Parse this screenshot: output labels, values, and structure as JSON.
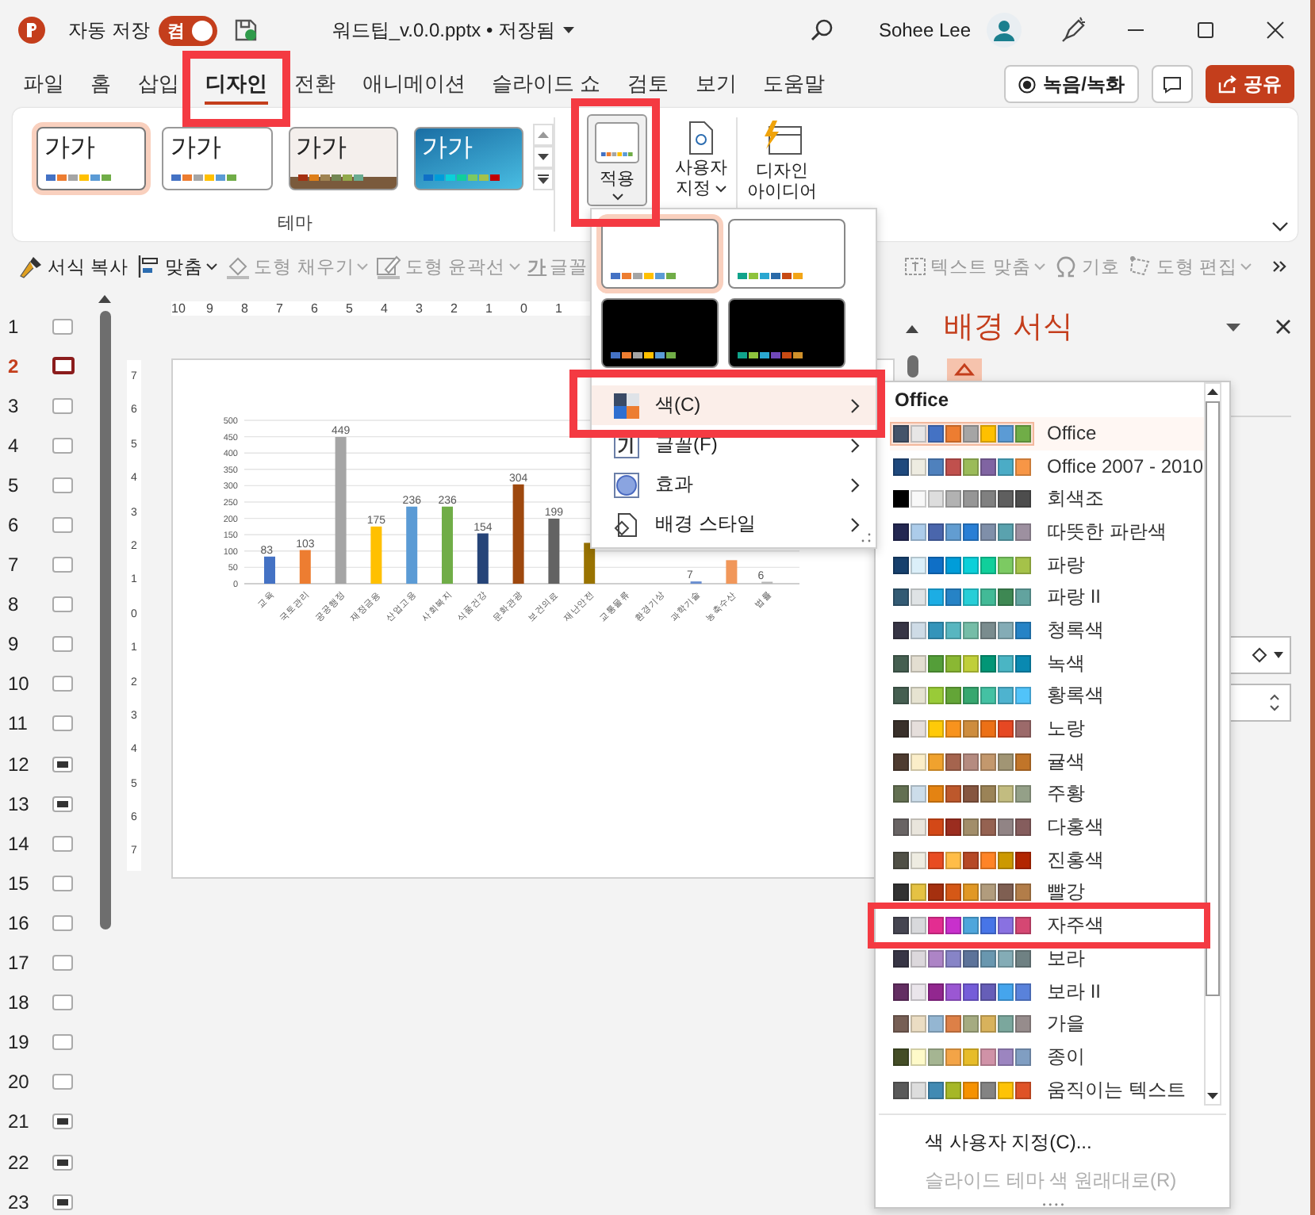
{
  "titlebar": {
    "autosave_label": "자동 저장",
    "autosave_toggle": {
      "label": "켬",
      "on": true
    },
    "filename": "워드팁_v.0.0.pptx • 저장됨",
    "user": "Sohee Lee"
  },
  "tabs": [
    {
      "label": "파일",
      "selected": false,
      "highlighted": false
    },
    {
      "label": "홈",
      "selected": false,
      "highlighted": false
    },
    {
      "label": "삽입",
      "selected": false,
      "highlighted": false
    },
    {
      "label": "디자인",
      "selected": true,
      "highlighted": true
    },
    {
      "label": "전환",
      "selected": false,
      "highlighted": false
    },
    {
      "label": "애니메이션",
      "selected": false,
      "highlighted": false
    },
    {
      "label": "슬라이드 쇼",
      "selected": false,
      "highlighted": false
    },
    {
      "label": "검토",
      "selected": false,
      "highlighted": false
    },
    {
      "label": "보기",
      "selected": false,
      "highlighted": false
    },
    {
      "label": "도움말",
      "selected": false,
      "highlighted": false
    }
  ],
  "header_buttons": {
    "record": "녹음/녹화",
    "share": "공유"
  },
  "ribbon": {
    "themes": [
      {
        "sample": "가가",
        "kind": "plain",
        "selected": true,
        "swatches": [
          {
            "color": "#4472c4"
          },
          {
            "color": "#ed7d31"
          },
          {
            "color": "#a5a5a5"
          },
          {
            "color": "#ffc000"
          },
          {
            "color": "#5b9bd5"
          },
          {
            "color": "#70ad47"
          }
        ]
      },
      {
        "sample": "가가",
        "kind": "plain",
        "selected": false,
        "swatches": [
          {
            "color": "#4472c4"
          },
          {
            "color": "#ed7d31"
          },
          {
            "color": "#a5a5a5"
          },
          {
            "color": "#ffc000"
          },
          {
            "color": "#5b9bd5"
          },
          {
            "color": "#70ad47"
          }
        ]
      },
      {
        "sample": "가가",
        "kind": "textured",
        "selected": false,
        "swatches": [
          {
            "color": "#a53010"
          },
          {
            "color": "#de7e18"
          },
          {
            "color": "#9f8351"
          },
          {
            "color": "#728653"
          },
          {
            "color": "#92aa4c"
          },
          {
            "color": "#6aac91"
          }
        ]
      },
      {
        "sample": "가가",
        "kind": "gradient",
        "selected": false,
        "swatches": [
          {
            "color": "#0f6fc6"
          },
          {
            "color": "#009dd9"
          },
          {
            "color": "#0bd0d9"
          },
          {
            "color": "#10cf9b"
          },
          {
            "color": "#7cca62"
          },
          {
            "color": "#a5c249"
          },
          {
            "color": "#c00000"
          }
        ]
      }
    ],
    "apply": {
      "label": "적용",
      "highlighted": true
    },
    "customize": "사용자 지정",
    "design_ideas": "디자인 아이디어",
    "group_label": "테마"
  },
  "toolbar": {
    "left": [
      {
        "label": "서식 복사",
        "disabled": false,
        "caret": false
      },
      {
        "label": "맞춤",
        "disabled": false,
        "caret": true
      },
      {
        "label": "도형 채우기",
        "disabled": true,
        "caret": true
      },
      {
        "label": "도형 윤곽선",
        "disabled": true,
        "caret": true
      },
      {
        "label": "글꼴",
        "glyph": "가",
        "disabled": true,
        "caret": false
      }
    ],
    "right": [
      {
        "label": "텍스트 맞춤",
        "disabled": true,
        "caret": true
      },
      {
        "label": "기호",
        "disabled": true,
        "caret": false
      },
      {
        "label": "도형 편집",
        "disabled": true,
        "caret": true
      }
    ]
  },
  "slides": [
    {
      "number": "1",
      "selected": false,
      "kind": "blank"
    },
    {
      "number": "2",
      "selected": true,
      "kind": "blank"
    },
    {
      "number": "3",
      "selected": false,
      "kind": "blank"
    },
    {
      "number": "4",
      "selected": false,
      "kind": "blank"
    },
    {
      "number": "5",
      "selected": false,
      "kind": "blank"
    },
    {
      "number": "6",
      "selected": false,
      "kind": "blank"
    },
    {
      "number": "7",
      "selected": false,
      "kind": "blank"
    },
    {
      "number": "8",
      "selected": false,
      "kind": "blank"
    },
    {
      "number": "9",
      "selected": false,
      "kind": "blank"
    },
    {
      "number": "10",
      "selected": false,
      "kind": "blank"
    },
    {
      "number": "11",
      "selected": false,
      "kind": "blank"
    },
    {
      "number": "12",
      "selected": false,
      "kind": "content"
    },
    {
      "number": "13",
      "selected": false,
      "kind": "content"
    },
    {
      "number": "14",
      "selected": false,
      "kind": "blank"
    },
    {
      "number": "15",
      "selected": false,
      "kind": "blank"
    },
    {
      "number": "16",
      "selected": false,
      "kind": "blank"
    },
    {
      "number": "17",
      "selected": false,
      "kind": "blank"
    },
    {
      "number": "18",
      "selected": false,
      "kind": "blank"
    },
    {
      "number": "19",
      "selected": false,
      "kind": "blank"
    },
    {
      "number": "20",
      "selected": false,
      "kind": "blank"
    },
    {
      "number": "21",
      "selected": false,
      "kind": "content"
    },
    {
      "number": "22",
      "selected": false,
      "kind": "content"
    },
    {
      "number": "23",
      "selected": false,
      "kind": "content"
    }
  ],
  "ruler": {
    "horizontal": [
      "10",
      "9",
      "8",
      "7",
      "6",
      "5",
      "4",
      "3",
      "2",
      "1",
      "0",
      "1"
    ],
    "vertical": [
      "7",
      "6",
      "5",
      "4",
      "3",
      "2",
      "1",
      "0",
      "1",
      "2",
      "3",
      "4",
      "5",
      "6",
      "7"
    ]
  },
  "slide": {
    "chart_data": {
      "type": "bar",
      "categories": [
        "교육",
        "국토관리",
        "공공행정",
        "재정금융",
        "산업고용",
        "사회복지",
        "식품건강",
        "문화관광",
        "보건의료",
        "재난안전",
        "교통물류",
        "환경기상",
        "과학기술",
        "농축수산",
        "법률"
      ],
      "values": [
        83,
        103,
        449,
        175,
        236,
        236,
        154,
        304,
        199,
        125,
        null,
        null,
        7,
        72,
        6
      ],
      "value_labels": [
        "83",
        "103",
        "449",
        "175",
        "236",
        "236",
        "154",
        "304",
        "199",
        null,
        null,
        null,
        "7",
        null,
        "6"
      ],
      "ylim": [
        0,
        500
      ],
      "yticks": [
        0,
        50,
        100,
        150,
        200,
        250,
        300,
        350,
        400,
        450,
        500
      ],
      "grid": true
    }
  },
  "pane": {
    "title": "배경 서식"
  },
  "design_menu": {
    "variants": [
      {
        "kind": "light",
        "selected": true,
        "swatches": [
          {
            "color": "#4472c4"
          },
          {
            "color": "#ed7d31"
          },
          {
            "color": "#a5a5a5"
          },
          {
            "color": "#ffc000"
          },
          {
            "color": "#5b9bd5"
          },
          {
            "color": "#70ad47"
          }
        ]
      },
      {
        "kind": "light",
        "selected": false,
        "swatches": [
          {
            "color": "#10a38b"
          },
          {
            "color": "#8ec33d"
          },
          {
            "color": "#2aa7d1"
          },
          {
            "color": "#2a6aa8"
          },
          {
            "color": "#c84a14"
          },
          {
            "color": "#f2a517"
          }
        ]
      },
      {
        "kind": "dark",
        "selected": false,
        "swatches": [
          {
            "color": "#4472c4"
          },
          {
            "color": "#ed7d31"
          },
          {
            "color": "#a5a5a5"
          },
          {
            "color": "#ffc000"
          },
          {
            "color": "#5b9bd5"
          },
          {
            "color": "#70ad47"
          }
        ]
      },
      {
        "kind": "dark",
        "selected": false,
        "swatches": [
          {
            "color": "#10a38b"
          },
          {
            "color": "#8ec33d"
          },
          {
            "color": "#2aa7d1"
          },
          {
            "color": "#7048b8"
          },
          {
            "color": "#c84a14"
          },
          {
            "color": "#d0902a"
          }
        ]
      }
    ],
    "items": [
      {
        "label": "색(C)",
        "hover": true,
        "highlighted": true
      },
      {
        "label": "글꼴(F)",
        "hover": false,
        "highlighted": false
      },
      {
        "label": "효과",
        "hover": false,
        "highlighted": false
      },
      {
        "label": "배경 스타일",
        "hover": false,
        "highlighted": false
      }
    ]
  },
  "color_menu": {
    "header": "Office",
    "schemes": [
      {
        "name": "Office",
        "selected": true,
        "highlighted": false,
        "swatches": [
          {
            "color": "#44546a"
          },
          {
            "color": "#e7e6e6"
          },
          {
            "color": "#4472c4"
          },
          {
            "color": "#ed7d31"
          },
          {
            "color": "#a5a5a5"
          },
          {
            "color": "#ffc000"
          },
          {
            "color": "#5b9bd5"
          },
          {
            "color": "#70ad47"
          }
        ]
      },
      {
        "name": "Office 2007 - 2010",
        "selected": false,
        "highlighted": false,
        "swatches": [
          {
            "color": "#1f497d"
          },
          {
            "color": "#eeece1"
          },
          {
            "color": "#4f81bd"
          },
          {
            "color": "#c0504d"
          },
          {
            "color": "#9bbb59"
          },
          {
            "color": "#8064a2"
          },
          {
            "color": "#4bacc6"
          },
          {
            "color": "#f79646"
          }
        ]
      },
      {
        "name": "회색조",
        "selected": false,
        "highlighted": false,
        "swatches": [
          {
            "color": "#000000"
          },
          {
            "color": "#f8f8f8"
          },
          {
            "color": "#dddddd"
          },
          {
            "color": "#b2b2b2"
          },
          {
            "color": "#969696"
          },
          {
            "color": "#808080"
          },
          {
            "color": "#5f5f5f"
          },
          {
            "color": "#4d4d4d"
          }
        ]
      },
      {
        "name": "따뜻한 파란색",
        "selected": false,
        "highlighted": false,
        "swatches": [
          {
            "color": "#242852"
          },
          {
            "color": "#acccea"
          },
          {
            "color": "#4a66ac"
          },
          {
            "color": "#629dd1"
          },
          {
            "color": "#297fd5"
          },
          {
            "color": "#7f8fa9"
          },
          {
            "color": "#5aa2ae"
          },
          {
            "color": "#9d90a0"
          }
        ]
      },
      {
        "name": "파랑",
        "selected": false,
        "highlighted": false,
        "swatches": [
          {
            "color": "#17406d"
          },
          {
            "color": "#dbeff9"
          },
          {
            "color": "#0f6fc6"
          },
          {
            "color": "#009dd9"
          },
          {
            "color": "#0bd0d9"
          },
          {
            "color": "#10cf9b"
          },
          {
            "color": "#7cca62"
          },
          {
            "color": "#a5c249"
          }
        ]
      },
      {
        "name": "파랑 II",
        "selected": false,
        "highlighted": false,
        "swatches": [
          {
            "color": "#335b74"
          },
          {
            "color": "#dfe3e5"
          },
          {
            "color": "#1cade4"
          },
          {
            "color": "#2683c6"
          },
          {
            "color": "#27ced7"
          },
          {
            "color": "#42ba97"
          },
          {
            "color": "#3e8853"
          },
          {
            "color": "#62a39f"
          }
        ]
      },
      {
        "name": "청록색",
        "selected": false,
        "highlighted": false,
        "swatches": [
          {
            "color": "#373545"
          },
          {
            "color": "#cedbe6"
          },
          {
            "color": "#3494ba"
          },
          {
            "color": "#58b6c0"
          },
          {
            "color": "#75bda7"
          },
          {
            "color": "#7a8c8e"
          },
          {
            "color": "#84acb6"
          },
          {
            "color": "#2683c6"
          }
        ]
      },
      {
        "name": "녹색",
        "selected": false,
        "highlighted": false,
        "swatches": [
          {
            "color": "#455f51"
          },
          {
            "color": "#e3ded1"
          },
          {
            "color": "#549e39"
          },
          {
            "color": "#8ab833"
          },
          {
            "color": "#c0cf3a"
          },
          {
            "color": "#029676"
          },
          {
            "color": "#4ab5c4"
          },
          {
            "color": "#0989b1"
          }
        ]
      },
      {
        "name": "황록색",
        "selected": false,
        "highlighted": false,
        "swatches": [
          {
            "color": "#455f51"
          },
          {
            "color": "#e6e3d1"
          },
          {
            "color": "#99cb38"
          },
          {
            "color": "#63a537"
          },
          {
            "color": "#37a76f"
          },
          {
            "color": "#44c1a3"
          },
          {
            "color": "#4eb3cf"
          },
          {
            "color": "#51c3f9"
          }
        ]
      },
      {
        "name": "노랑",
        "selected": false,
        "highlighted": false,
        "swatches": [
          {
            "color": "#39302a"
          },
          {
            "color": "#e5dedb"
          },
          {
            "color": "#ffca08"
          },
          {
            "color": "#f8931d"
          },
          {
            "color": "#ce8d3e"
          },
          {
            "color": "#ec7016"
          },
          {
            "color": "#e64823"
          },
          {
            "color": "#9c6a6a"
          }
        ]
      },
      {
        "name": "귤색",
        "selected": false,
        "highlighted": false,
        "swatches": [
          {
            "color": "#4e3b30"
          },
          {
            "color": "#fbeec9"
          },
          {
            "color": "#f0a22e"
          },
          {
            "color": "#a5644e"
          },
          {
            "color": "#b58b80"
          },
          {
            "color": "#c3986d"
          },
          {
            "color": "#a19574"
          },
          {
            "color": "#c17529"
          }
        ]
      },
      {
        "name": "주황",
        "selected": false,
        "highlighted": false,
        "swatches": [
          {
            "color": "#637052"
          },
          {
            "color": "#ccddea"
          },
          {
            "color": "#e48312"
          },
          {
            "color": "#bd582c"
          },
          {
            "color": "#865640"
          },
          {
            "color": "#9b8357"
          },
          {
            "color": "#c2bc80"
          },
          {
            "color": "#94a088"
          }
        ]
      },
      {
        "name": "다홍색",
        "selected": false,
        "highlighted": false,
        "swatches": [
          {
            "color": "#696464"
          },
          {
            "color": "#e9e5dc"
          },
          {
            "color": "#d34817"
          },
          {
            "color": "#9b2d1f"
          },
          {
            "color": "#a28e6a"
          },
          {
            "color": "#956251"
          },
          {
            "color": "#918485"
          },
          {
            "color": "#855d5d"
          }
        ]
      },
      {
        "name": "진홍색",
        "selected": false,
        "highlighted": false,
        "swatches": [
          {
            "color": "#505046"
          },
          {
            "color": "#eeece1"
          },
          {
            "color": "#e84c22"
          },
          {
            "color": "#ffbd47"
          },
          {
            "color": "#b64926"
          },
          {
            "color": "#ff8427"
          },
          {
            "color": "#cc9900"
          },
          {
            "color": "#b22600"
          }
        ]
      },
      {
        "name": "빨강",
        "selected": false,
        "highlighted": false,
        "swatches": [
          {
            "color": "#323232"
          },
          {
            "color": "#e5c243"
          },
          {
            "color": "#a5300f"
          },
          {
            "color": "#d55816"
          },
          {
            "color": "#e19825"
          },
          {
            "color": "#b19c7d"
          },
          {
            "color": "#7f5f52"
          },
          {
            "color": "#b27d49"
          }
        ]
      },
      {
        "name": "자주색",
        "selected": false,
        "highlighted": true,
        "swatches": [
          {
            "color": "#454551"
          },
          {
            "color": "#d8d9dc"
          },
          {
            "color": "#e32d91"
          },
          {
            "color": "#c830cc"
          },
          {
            "color": "#4ea6dc"
          },
          {
            "color": "#4775e7"
          },
          {
            "color": "#8971e1"
          },
          {
            "color": "#d54773"
          }
        ]
      },
      {
        "name": "보라",
        "selected": false,
        "highlighted": false,
        "swatches": [
          {
            "color": "#373545"
          },
          {
            "color": "#dcd8dc"
          },
          {
            "color": "#ad84c6"
          },
          {
            "color": "#8784c7"
          },
          {
            "color": "#5d739a"
          },
          {
            "color": "#6997af"
          },
          {
            "color": "#84acb6"
          },
          {
            "color": "#6f8183"
          }
        ]
      },
      {
        "name": "보라 II",
        "selected": false,
        "highlighted": false,
        "swatches": [
          {
            "color": "#632e62"
          },
          {
            "color": "#eae5eb"
          },
          {
            "color": "#92278f"
          },
          {
            "color": "#9b57d3"
          },
          {
            "color": "#755dd9"
          },
          {
            "color": "#665eb8"
          },
          {
            "color": "#45a5ed"
          },
          {
            "color": "#5982db"
          }
        ]
      },
      {
        "name": "가을",
        "selected": false,
        "highlighted": false,
        "swatches": [
          {
            "color": "#775f55"
          },
          {
            "color": "#ebddc3"
          },
          {
            "color": "#94b6d2"
          },
          {
            "color": "#dd8047"
          },
          {
            "color": "#a5ab81"
          },
          {
            "color": "#d8b25c"
          },
          {
            "color": "#7ba79d"
          },
          {
            "color": "#968c8c"
          }
        ]
      },
      {
        "name": "종이",
        "selected": false,
        "highlighted": false,
        "swatches": [
          {
            "color": "#444d26"
          },
          {
            "color": "#fefac9"
          },
          {
            "color": "#a5b592"
          },
          {
            "color": "#f3a447"
          },
          {
            "color": "#e7bc29"
          },
          {
            "color": "#d092a7"
          },
          {
            "color": "#9c85c0"
          },
          {
            "color": "#809ec2"
          }
        ]
      },
      {
        "name": "움직이는 텍스트",
        "selected": false,
        "highlighted": false,
        "swatches": [
          {
            "color": "#595959"
          },
          {
            "color": "#dddddd"
          },
          {
            "color": "#418ab3"
          },
          {
            "color": "#a6b727"
          },
          {
            "color": "#f69200"
          },
          {
            "color": "#838383"
          },
          {
            "color": "#fec306"
          },
          {
            "color": "#df5327"
          }
        ]
      }
    ],
    "footer": [
      {
        "label": "색 사용자 지정(C)...",
        "disabled": false
      },
      {
        "label": "슬라이드 테마 색 원래대로(R)",
        "disabled": true
      }
    ]
  }
}
